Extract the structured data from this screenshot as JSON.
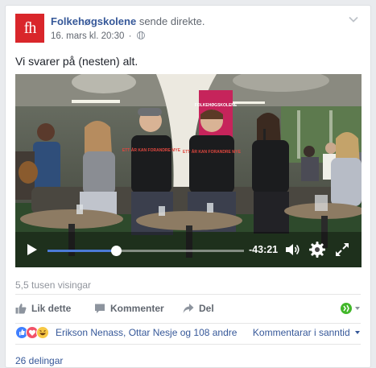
{
  "post": {
    "page_logo_text": "fh",
    "author_name": "Folkehøgskolene",
    "author_action": "sende direkte.",
    "timestamp": "16. mars kl. 20:30",
    "meta_separator": "·",
    "text": "Vi svarer på (nesten) alt."
  },
  "video": {
    "progress": 0.35,
    "time_remaining": "-43:21",
    "shirt_text": "ETT ÅR KAN FORANDRE MYE",
    "banner_text": "FOLKEHØGSKOLENE"
  },
  "views": "5,5 tusen visingar",
  "actions": {
    "like": "Lik dette",
    "comment": "Kommenter",
    "share": "Del"
  },
  "reactions": {
    "icons": [
      "like-icon",
      "love-icon",
      "haha-icon"
    ],
    "reactors": "Erikson Nenass, Ottar Nesje og 108 andre",
    "comment_order": "Kommentarar i sanntid"
  },
  "shares": "26 delingar",
  "colors": {
    "link": "#365899",
    "logo": "#d9262b",
    "progress": "#4b7bd6"
  }
}
